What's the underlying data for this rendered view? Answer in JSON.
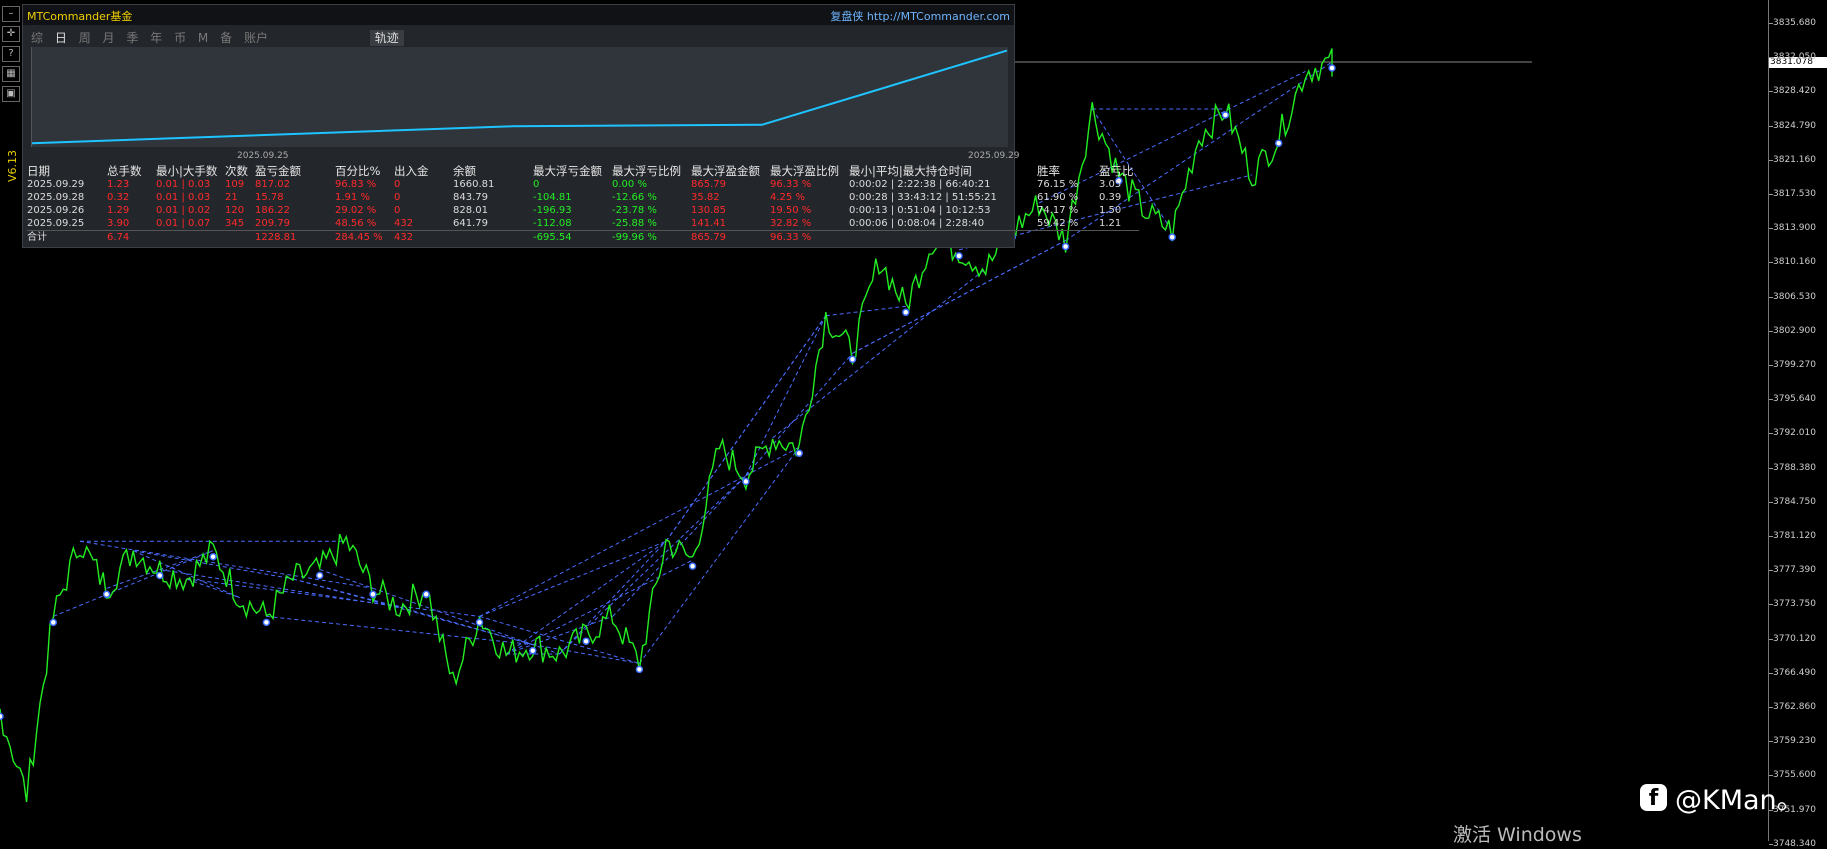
{
  "panel": {
    "title": "MTCommander基金",
    "right_text": "复盘侠 http://MTCommander.com",
    "tabs": [
      "综",
      "日",
      "周",
      "月",
      "季",
      "年",
      "币",
      "M",
      "备",
      "账户"
    ],
    "active_tab": "日",
    "track_button": "轨迹",
    "equity_start_date": "2025.09.25",
    "equity_end_date": "2025.09.29",
    "equity_curve": [
      641.79,
      828.01,
      843.79,
      1660.81
    ],
    "line_color": "#1ec4ff"
  },
  "version": "V6.13",
  "stats": {
    "headers": [
      "日期",
      "总手数",
      "最小|大手数",
      "次数",
      "盈亏金额",
      "百分比%",
      "出入金",
      "余额",
      "最大浮亏金额",
      "最大浮亏比例",
      "最大浮盈金额",
      "最大浮盈比例",
      "最小|平均|最大持仓时间",
      "胜率",
      "盈亏比"
    ],
    "rows": [
      [
        "2025.09.29",
        "1.23",
        "0.01 | 0.03",
        "109",
        "817.02",
        "96.83 %",
        "0",
        "1660.81",
        "0",
        "0.00 %",
        "865.79",
        "96.33 %",
        "0:00:02 | 2:22:38 | 66:40:21",
        "76.15 %",
        "3.05"
      ],
      [
        "2025.09.28",
        "0.32",
        "0.01 | 0.03",
        "21",
        "15.78",
        "1.91 %",
        "0",
        "843.79",
        "-104.81",
        "-12.66 %",
        "35.82",
        "4.25 %",
        "0:00:28 | 33:43:12 | 51:55:21",
        "61.90 %",
        "0.39"
      ],
      [
        "2025.09.26",
        "1.29",
        "0.01 | 0.02",
        "120",
        "186.22",
        "29.02 %",
        "0",
        "828.01",
        "-196.93",
        "-23.78 %",
        "130.85",
        "19.50 %",
        "0:00:13 | 0:51:04 | 10:12:53",
        "74.17 %",
        "1.50"
      ],
      [
        "2025.09.25",
        "3.90",
        "0.01 | 0.07",
        "345",
        "209.79",
        "48.56 %",
        "432",
        "641.79",
        "-112.08",
        "-25.88 %",
        "141.41",
        "32.82 %",
        "0:00:06 | 0:08:04 | 2:28:40",
        "59.42 %",
        "1.21"
      ]
    ],
    "total": [
      "合计",
      "6.74",
      "",
      "",
      "1228.81",
      "284.45 %",
      "432",
      "",
      "-695.54",
      "-99.96 %",
      "865.79",
      "96.33 %",
      "",
      "",
      ""
    ]
  },
  "price_axis": {
    "labels": [
      "3835.680",
      "3832.050",
      "3828.420",
      "3824.790",
      "3821.160",
      "3817.530",
      "3813.900",
      "3810.160",
      "3806.530",
      "3802.900",
      "3799.270",
      "3795.640",
      "3792.010",
      "3788.380",
      "3784.750",
      "3781.120",
      "3777.390",
      "3773.750",
      "3770.120",
      "3766.490",
      "3762.860",
      "3759.230",
      "3755.600",
      "3751.970",
      "3748.340"
    ],
    "current_price": "3831.078"
  },
  "chart_data": {
    "type": "line",
    "ylim": [
      3748.34,
      3835.68
    ],
    "series": [
      {
        "values": [
          3762,
          3753,
          3772,
          3780,
          3775,
          3779,
          3777,
          3776,
          3779,
          3774,
          3772,
          3776,
          3777,
          3780,
          3775,
          3773,
          3775,
          3765,
          3772,
          3768,
          3769,
          3768,
          3770,
          3772,
          3767,
          3780,
          3778,
          3790,
          3787,
          3791,
          3790,
          3804,
          3800,
          3810,
          3805,
          3812,
          3811,
          3809,
          3813,
          3816,
          3812,
          3826,
          3819,
          3815,
          3813,
          3823,
          3826,
          3819,
          3823,
          3830,
          3831
        ]
      }
    ],
    "colors": {
      "price": "#22ee22",
      "links": "#4a6cff"
    }
  },
  "watermark": "@KMan。",
  "activate_text": "激活 Windows"
}
